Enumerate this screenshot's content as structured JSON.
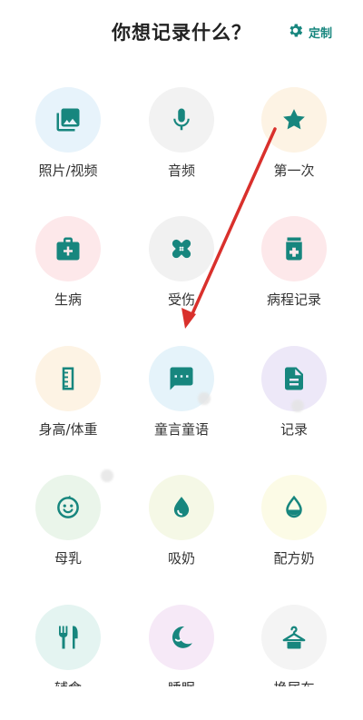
{
  "header": {
    "title": "你想记录什么？",
    "customize_label": "定制"
  },
  "theme": {
    "accent": "#17867e",
    "arrow": "#d9302c"
  },
  "items": [
    {
      "label": "照片/视频",
      "icon": "photo-icon",
      "bg": "#e7f3fb"
    },
    {
      "label": "音频",
      "icon": "microphone-icon",
      "bg": "#f2f2f2"
    },
    {
      "label": "第一次",
      "icon": "star-icon",
      "bg": "#fdf3e4"
    },
    {
      "label": "生病",
      "icon": "medical-kit-icon",
      "bg": "#fde8ea"
    },
    {
      "label": "受伤",
      "icon": "bandage-icon",
      "bg": "#f1f1f1"
    },
    {
      "label": "病程记录",
      "icon": "medicine-bottle-icon",
      "bg": "#fde8ea"
    },
    {
      "label": "身高/体重",
      "icon": "ruler-icon",
      "bg": "#fdf3e4"
    },
    {
      "label": "童言童语",
      "icon": "speech-bubble-icon",
      "bg": "#e5f3fa"
    },
    {
      "label": "记录",
      "icon": "document-icon",
      "bg": "#ede8f8"
    },
    {
      "label": "母乳",
      "icon": "baby-face-icon",
      "bg": "#eaf5ea"
    },
    {
      "label": "吸奶",
      "icon": "milk-drop-icon",
      "bg": "#f5f8e6"
    },
    {
      "label": "配方奶",
      "icon": "formula-drop-icon",
      "bg": "#fcfbe6"
    },
    {
      "label": "辅食",
      "icon": "fork-knife-icon",
      "bg": "#e4f4f1"
    },
    {
      "label": "睡眠",
      "icon": "moon-icon",
      "bg": "#f6e9f7"
    },
    {
      "label": "换尿布",
      "icon": "hanger-icon",
      "bg": "#f4f4f4"
    }
  ]
}
